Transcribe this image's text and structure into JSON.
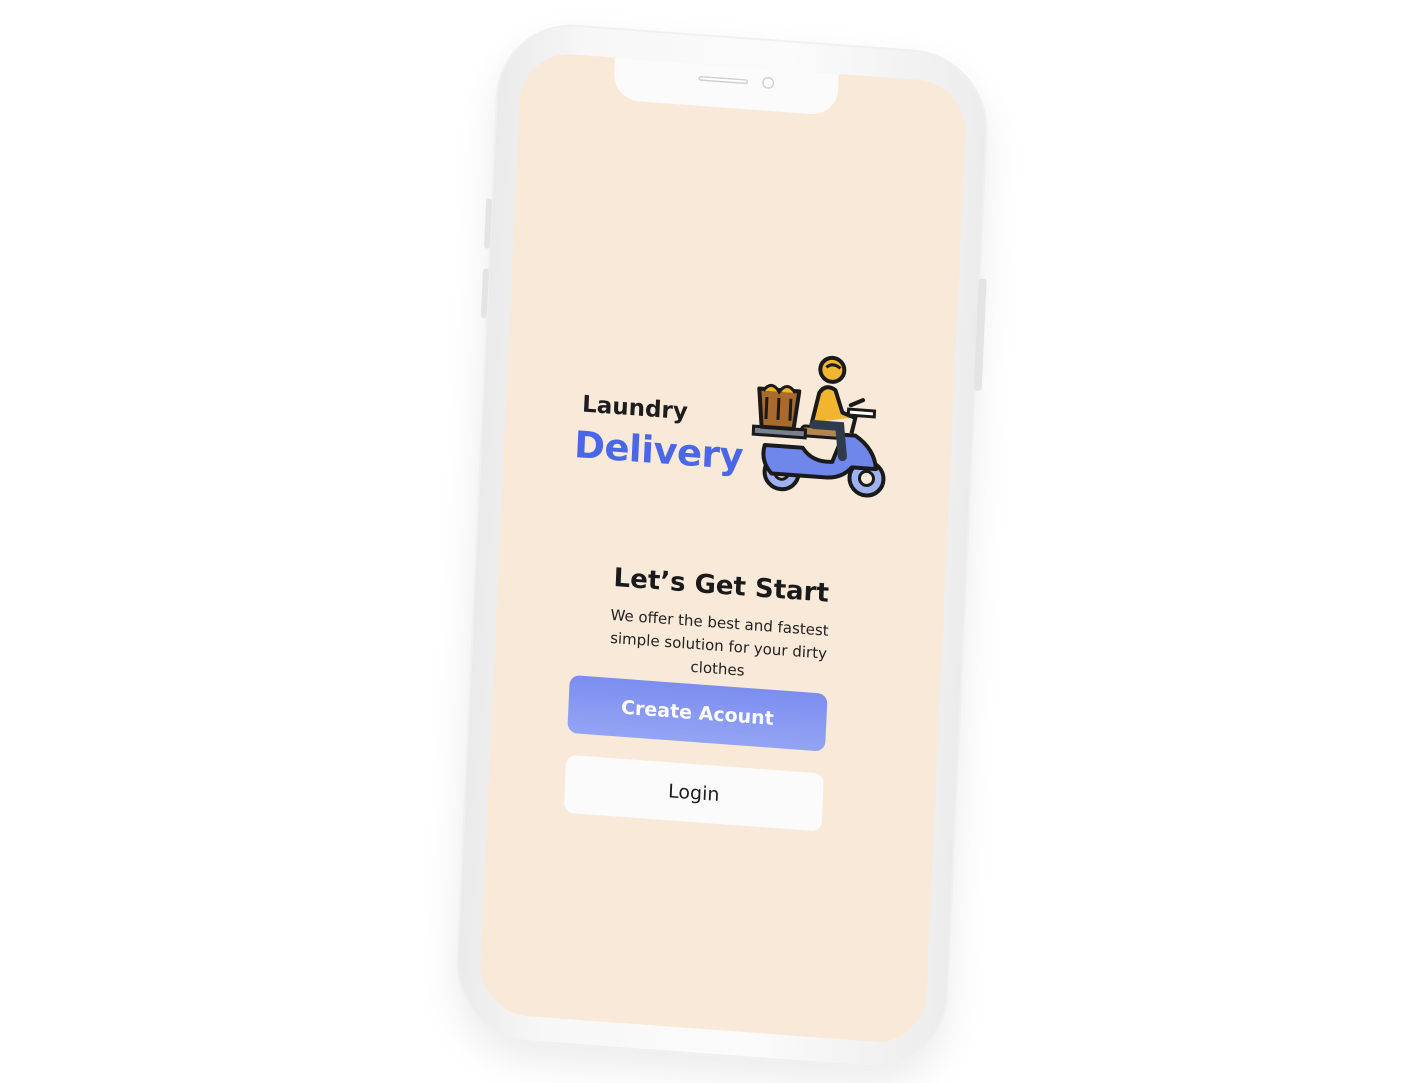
{
  "app": {
    "logo_line1": "Laundry",
    "logo_line2": "Delivery",
    "logo_icon": "scooter-delivery-icon"
  },
  "welcome": {
    "headline": "Let’s Get Start",
    "subtitle": "We offer the best and fastest simple solution for your dirty clothes"
  },
  "actions": {
    "create_account_label": "Create Acount",
    "login_label": "Login"
  },
  "colors": {
    "screen_background": "#f9e9d9",
    "brand_blue": "#4a67e8",
    "primary_button": "#8497f2",
    "secondary_button": "#fbfbfb"
  }
}
